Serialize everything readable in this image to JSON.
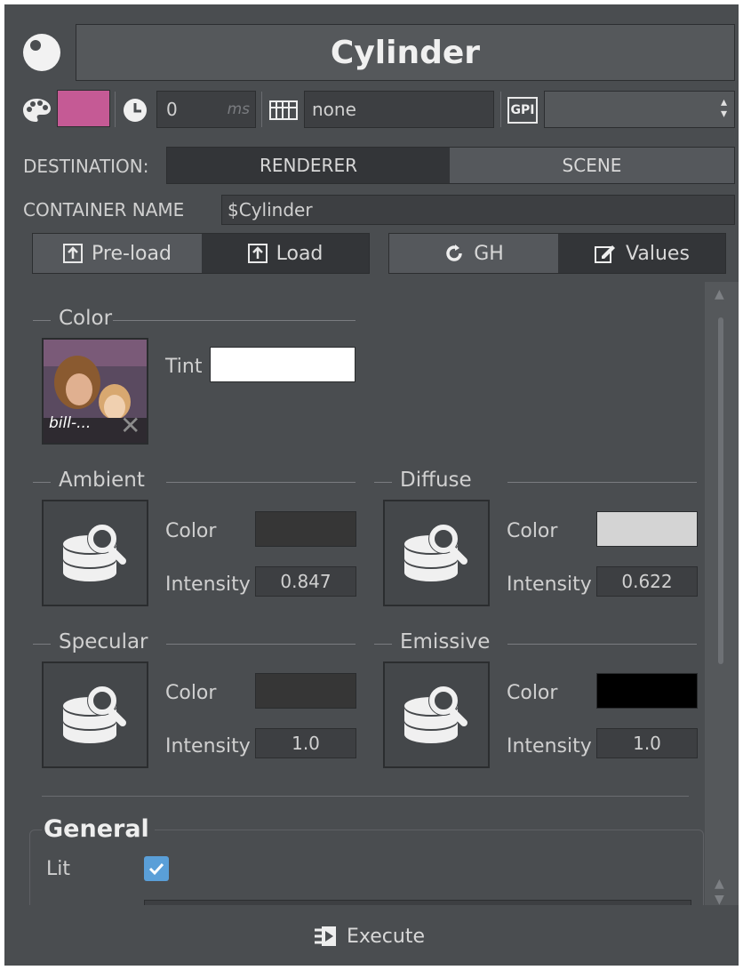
{
  "header": {
    "title": "Cylinder"
  },
  "toolbar": {
    "color_swatch": "#c55a95",
    "delay_value": "0",
    "delay_unit": "ms",
    "keyframe_value": "none",
    "gpi_label": "GPI",
    "gpi_select": ""
  },
  "destination": {
    "label": "DESTINATION:",
    "options": [
      "RENDERER",
      "SCENE"
    ],
    "selected": "RENDERER"
  },
  "container": {
    "label": "CONTAINER NAME",
    "value": "$Cylinder"
  },
  "actions": {
    "preload": "Pre-load",
    "load": "Load",
    "gh": "GH",
    "values": "Values"
  },
  "color_section": {
    "title": "Color",
    "image_caption": "bill-...",
    "tint_label": "Tint",
    "tint_color": "#ffffff"
  },
  "materials": [
    {
      "title": "Ambient",
      "color_label": "Color",
      "color": "#363636",
      "intensity_label": "Intensity",
      "intensity": "0.847"
    },
    {
      "title": "Diffuse",
      "color_label": "Color",
      "color": "#d4d4d4",
      "intensity_label": "Intensity",
      "intensity": "0.622"
    },
    {
      "title": "Specular",
      "color_label": "Color",
      "color": "#363636",
      "intensity_label": "Intensity",
      "intensity": "1.0"
    },
    {
      "title": "Emissive",
      "color_label": "Color",
      "color": "#000000",
      "intensity_label": "Intensity",
      "intensity": "1.0"
    }
  ],
  "general": {
    "title": "General",
    "lit_label": "Lit",
    "lit_checked": true
  },
  "footer": {
    "execute": "Execute"
  }
}
